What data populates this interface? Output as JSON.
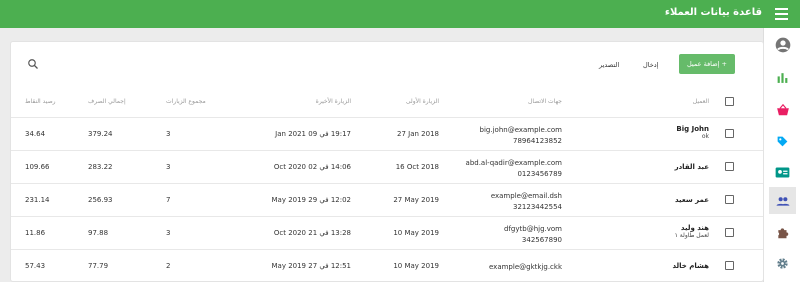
{
  "app": {
    "title": "قاعدة بيانات العملاء"
  },
  "toolbar": {
    "add_label": "+ إضافة عميل",
    "import_label": "إدخال",
    "export_label": "التصدير"
  },
  "table": {
    "headers": {
      "customer": "العميل",
      "contact": "جهات الاتصال",
      "first_visit": "الزيارة الأولى",
      "last_visit": "الزيارة الأخيرة",
      "total_visits": "مجموع الزيارات",
      "total_spent": "إجمالي الصرف",
      "points": "رصيد النقاط"
    },
    "rows": [
      {
        "name": "Big John",
        "note": "ok",
        "email": "big.john@example.com",
        "phone": "78964123852",
        "first_visit": "27 Jan 2018",
        "last_visit": "19:17 في 09 Jan 2021",
        "visits": "3",
        "spent": "379.24",
        "points": "34.64"
      },
      {
        "name": "عبد القادر",
        "note": "",
        "email": "abd.al-qadir@example.com",
        "phone": "0123456789",
        "first_visit": "16 Oct 2018",
        "last_visit": "14:06 في 02 Oct 2020",
        "visits": "3",
        "spent": "283.22",
        "points": "109.66"
      },
      {
        "name": "عمر سعيد",
        "note": "",
        "email": "example@email.dsh",
        "phone": "32123442554",
        "first_visit": "27 May 2019",
        "last_visit": "12:02 في 29 May 2019",
        "visits": "7",
        "spent": "256.93",
        "points": "231.14"
      },
      {
        "name": "هند وليد",
        "note": "لعمل طاولة ١",
        "email": "dfgytb@hjg.vom",
        "phone": "342567890",
        "first_visit": "10 May 2019",
        "last_visit": "13:28 في 21 Oct 2020",
        "visits": "3",
        "spent": "97.88",
        "points": "11.86"
      },
      {
        "name": "هشام خالد",
        "note": "",
        "email": "example@gktkjg.ckk",
        "phone": "",
        "first_visit": "10 May 2019",
        "last_visit": "12:51 في 27 May 2019",
        "visits": "2",
        "spent": "77.79",
        "points": "57.43"
      }
    ]
  },
  "sidebar": {
    "items": [
      {
        "icon": "account-circle-icon",
        "color": "#757575"
      },
      {
        "icon": "bar-chart-icon",
        "color": "#4caf50"
      },
      {
        "icon": "basket-icon",
        "color": "#e91e63"
      },
      {
        "icon": "tag-icon",
        "color": "#03a9f4"
      },
      {
        "icon": "id-card-icon",
        "color": "#009688"
      },
      {
        "icon": "people-icon",
        "color": "#3f51b5"
      },
      {
        "icon": "puzzle-icon",
        "color": "#795548"
      },
      {
        "icon": "gear-icon",
        "color": "#607d8b"
      }
    ]
  }
}
